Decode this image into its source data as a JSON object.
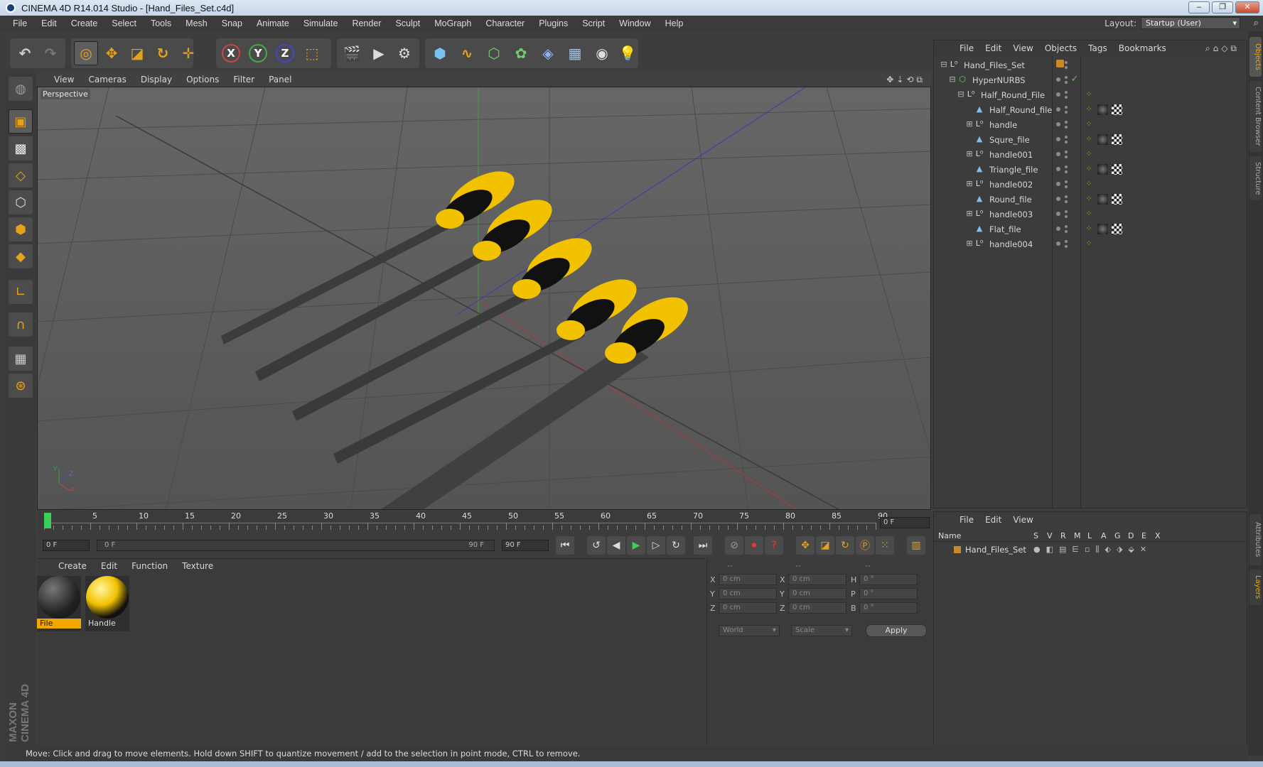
{
  "window": {
    "title": "CINEMA 4D R14.014 Studio - [Hand_Files_Set.c4d]",
    "minimize": "–",
    "restore": "❐",
    "close": "✕"
  },
  "menu": [
    "File",
    "Edit",
    "Create",
    "Select",
    "Tools",
    "Mesh",
    "Snap",
    "Animate",
    "Simulate",
    "Render",
    "Sculpt",
    "MoGraph",
    "Character",
    "Plugins",
    "Script",
    "Window",
    "Help"
  ],
  "layout": {
    "label": "Layout:",
    "value": "Startup (User)"
  },
  "viewport": {
    "menu": [
      "View",
      "Cameras",
      "Display",
      "Options",
      "Filter",
      "Panel"
    ],
    "camera_label": "Perspective",
    "axis": {
      "x": "X",
      "y": "Y",
      "z": "Z"
    }
  },
  "timeline": {
    "ticks": [
      "0",
      "5",
      "10",
      "15",
      "20",
      "25",
      "30",
      "35",
      "40",
      "45",
      "50",
      "55",
      "60",
      "65",
      "70",
      "75",
      "80",
      "85",
      "90"
    ],
    "current_frame": "0 F",
    "start_field": "0 F",
    "range_left": "0 F",
    "range_right": "90 F",
    "end_field": "90 F"
  },
  "material_manager": {
    "menu": [
      "Create",
      "Edit",
      "Function",
      "Texture"
    ],
    "materials": [
      {
        "name": "File",
        "selected": true
      },
      {
        "name": "Handle",
        "selected": false
      }
    ]
  },
  "coordinates": {
    "header": [
      "--",
      "--",
      "--"
    ],
    "rows": [
      {
        "axis": "X",
        "pos": "0 cm",
        "axis2": "X",
        "size": "0 cm",
        "rot_label": "H",
        "rot": "0 °"
      },
      {
        "axis": "Y",
        "pos": "0 cm",
        "axis2": "Y",
        "size": "0 cm",
        "rot_label": "P",
        "rot": "0 °"
      },
      {
        "axis": "Z",
        "pos": "0 cm",
        "axis2": "Z",
        "size": "0 cm",
        "rot_label": "B",
        "rot": "0 °"
      }
    ],
    "space": "World",
    "mode": "Scale",
    "apply": "Apply"
  },
  "object_manager": {
    "menu": [
      "File",
      "Edit",
      "View",
      "Objects",
      "Tags",
      "Bookmarks"
    ],
    "objects": [
      {
        "name": "Hand_Files_Set",
        "type": "null",
        "depth": 0,
        "expand": "⊟",
        "tags": []
      },
      {
        "name": "HyperNURBS",
        "type": "hypernurbs",
        "depth": 1,
        "expand": "⊟",
        "tags": [
          "check"
        ]
      },
      {
        "name": "Half_Round_File",
        "type": "null",
        "depth": 2,
        "expand": "⊟",
        "tags": [
          "phong"
        ]
      },
      {
        "name": "Half_Round_file",
        "type": "poly",
        "depth": 3,
        "expand": "",
        "tags": [
          "phong",
          "mat1",
          "mat2"
        ]
      },
      {
        "name": "handle",
        "type": "null",
        "depth": 3,
        "expand": "⊞",
        "tags": [
          "phong"
        ]
      },
      {
        "name": "Squre_file",
        "type": "poly",
        "depth": 3,
        "expand": "",
        "tags": [
          "phong",
          "mat1",
          "mat2"
        ]
      },
      {
        "name": "handle001",
        "type": "null",
        "depth": 3,
        "expand": "⊞",
        "tags": [
          "phong"
        ]
      },
      {
        "name": "Triangle_file",
        "type": "poly",
        "depth": 3,
        "expand": "",
        "tags": [
          "phong",
          "mat1",
          "mat2"
        ]
      },
      {
        "name": "handle002",
        "type": "null",
        "depth": 3,
        "expand": "⊞",
        "tags": [
          "phong"
        ]
      },
      {
        "name": "Round_file",
        "type": "poly",
        "depth": 3,
        "expand": "",
        "tags": [
          "phong",
          "mat1",
          "mat2"
        ]
      },
      {
        "name": "handle003",
        "type": "null",
        "depth": 3,
        "expand": "⊞",
        "tags": [
          "phong"
        ]
      },
      {
        "name": "Flat_file",
        "type": "poly",
        "depth": 3,
        "expand": "",
        "tags": [
          "phong",
          "mat1",
          "mat2"
        ]
      },
      {
        "name": "handle004",
        "type": "null",
        "depth": 3,
        "expand": "⊞",
        "tags": [
          "phong"
        ]
      }
    ]
  },
  "layer_manager": {
    "menu": [
      "File",
      "Edit",
      "View"
    ],
    "columns": [
      "Name",
      "S",
      "V",
      "R",
      "M",
      "L",
      "A",
      "G",
      "D",
      "E",
      "X"
    ],
    "layers": [
      {
        "name": "Hand_Files_Set"
      }
    ]
  },
  "right_tabs": [
    "Objects",
    "Content Browser",
    "Structure",
    "Attributes",
    "Layers"
  ],
  "brand": "MAXON CINEMA 4D",
  "status": "Move: Click and drag to move elements. Hold down SHIFT to quantize movement / add to the selection in point mode, CTRL to remove.",
  "colors": {
    "accent": "#e8a516",
    "selected": "#f0a800",
    "handle_yellow": "#f2c200",
    "bg": "#3d3d3d"
  }
}
